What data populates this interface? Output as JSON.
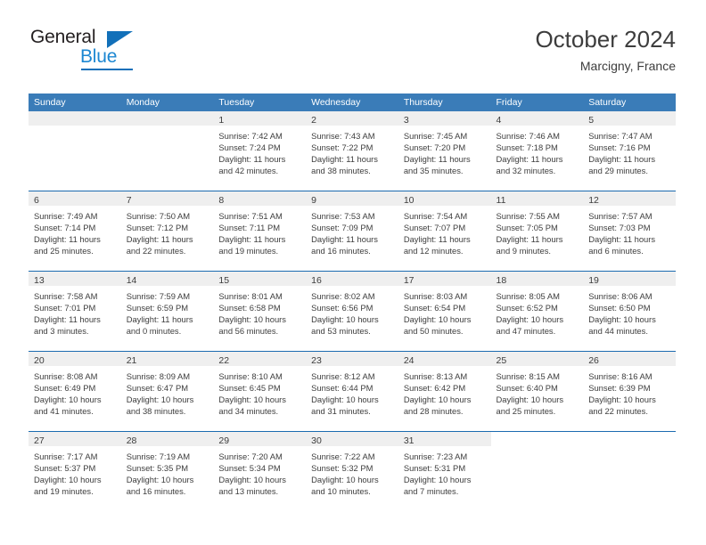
{
  "brand": {
    "name_dark": "General",
    "name_blue": "Blue",
    "logo_icon": "triangle-icon",
    "blue": "#1270b9"
  },
  "header": {
    "title": "October 2024",
    "subtitle": "Marcigny, France"
  },
  "calendar": {
    "header_bg": "#3a7cb8",
    "row_rule": "#1b6bb0",
    "daynum_bg": "#efefef",
    "weekdays": [
      "Sunday",
      "Monday",
      "Tuesday",
      "Wednesday",
      "Thursday",
      "Friday",
      "Saturday"
    ],
    "weeks": [
      [
        {
          "day": "",
          "blank": true,
          "sunrise": "",
          "sunset": "",
          "daylight": ""
        },
        {
          "day": "",
          "blank": true,
          "sunrise": "",
          "sunset": "",
          "daylight": ""
        },
        {
          "day": "1",
          "sunrise": "Sunrise: 7:42 AM",
          "sunset": "Sunset: 7:24 PM",
          "daylight": "Daylight: 11 hours and 42 minutes."
        },
        {
          "day": "2",
          "sunrise": "Sunrise: 7:43 AM",
          "sunset": "Sunset: 7:22 PM",
          "daylight": "Daylight: 11 hours and 38 minutes."
        },
        {
          "day": "3",
          "sunrise": "Sunrise: 7:45 AM",
          "sunset": "Sunset: 7:20 PM",
          "daylight": "Daylight: 11 hours and 35 minutes."
        },
        {
          "day": "4",
          "sunrise": "Sunrise: 7:46 AM",
          "sunset": "Sunset: 7:18 PM",
          "daylight": "Daylight: 11 hours and 32 minutes."
        },
        {
          "day": "5",
          "sunrise": "Sunrise: 7:47 AM",
          "sunset": "Sunset: 7:16 PM",
          "daylight": "Daylight: 11 hours and 29 minutes."
        }
      ],
      [
        {
          "day": "6",
          "sunrise": "Sunrise: 7:49 AM",
          "sunset": "Sunset: 7:14 PM",
          "daylight": "Daylight: 11 hours and 25 minutes."
        },
        {
          "day": "7",
          "sunrise": "Sunrise: 7:50 AM",
          "sunset": "Sunset: 7:12 PM",
          "daylight": "Daylight: 11 hours and 22 minutes."
        },
        {
          "day": "8",
          "sunrise": "Sunrise: 7:51 AM",
          "sunset": "Sunset: 7:11 PM",
          "daylight": "Daylight: 11 hours and 19 minutes."
        },
        {
          "day": "9",
          "sunrise": "Sunrise: 7:53 AM",
          "sunset": "Sunset: 7:09 PM",
          "daylight": "Daylight: 11 hours and 16 minutes."
        },
        {
          "day": "10",
          "sunrise": "Sunrise: 7:54 AM",
          "sunset": "Sunset: 7:07 PM",
          "daylight": "Daylight: 11 hours and 12 minutes."
        },
        {
          "day": "11",
          "sunrise": "Sunrise: 7:55 AM",
          "sunset": "Sunset: 7:05 PM",
          "daylight": "Daylight: 11 hours and 9 minutes."
        },
        {
          "day": "12",
          "sunrise": "Sunrise: 7:57 AM",
          "sunset": "Sunset: 7:03 PM",
          "daylight": "Daylight: 11 hours and 6 minutes."
        }
      ],
      [
        {
          "day": "13",
          "sunrise": "Sunrise: 7:58 AM",
          "sunset": "Sunset: 7:01 PM",
          "daylight": "Daylight: 11 hours and 3 minutes."
        },
        {
          "day": "14",
          "sunrise": "Sunrise: 7:59 AM",
          "sunset": "Sunset: 6:59 PM",
          "daylight": "Daylight: 11 hours and 0 minutes."
        },
        {
          "day": "15",
          "sunrise": "Sunrise: 8:01 AM",
          "sunset": "Sunset: 6:58 PM",
          "daylight": "Daylight: 10 hours and 56 minutes."
        },
        {
          "day": "16",
          "sunrise": "Sunrise: 8:02 AM",
          "sunset": "Sunset: 6:56 PM",
          "daylight": "Daylight: 10 hours and 53 minutes."
        },
        {
          "day": "17",
          "sunrise": "Sunrise: 8:03 AM",
          "sunset": "Sunset: 6:54 PM",
          "daylight": "Daylight: 10 hours and 50 minutes."
        },
        {
          "day": "18",
          "sunrise": "Sunrise: 8:05 AM",
          "sunset": "Sunset: 6:52 PM",
          "daylight": "Daylight: 10 hours and 47 minutes."
        },
        {
          "day": "19",
          "sunrise": "Sunrise: 8:06 AM",
          "sunset": "Sunset: 6:50 PM",
          "daylight": "Daylight: 10 hours and 44 minutes."
        }
      ],
      [
        {
          "day": "20",
          "sunrise": "Sunrise: 8:08 AM",
          "sunset": "Sunset: 6:49 PM",
          "daylight": "Daylight: 10 hours and 41 minutes."
        },
        {
          "day": "21",
          "sunrise": "Sunrise: 8:09 AM",
          "sunset": "Sunset: 6:47 PM",
          "daylight": "Daylight: 10 hours and 38 minutes."
        },
        {
          "day": "22",
          "sunrise": "Sunrise: 8:10 AM",
          "sunset": "Sunset: 6:45 PM",
          "daylight": "Daylight: 10 hours and 34 minutes."
        },
        {
          "day": "23",
          "sunrise": "Sunrise: 8:12 AM",
          "sunset": "Sunset: 6:44 PM",
          "daylight": "Daylight: 10 hours and 31 minutes."
        },
        {
          "day": "24",
          "sunrise": "Sunrise: 8:13 AM",
          "sunset": "Sunset: 6:42 PM",
          "daylight": "Daylight: 10 hours and 28 minutes."
        },
        {
          "day": "25",
          "sunrise": "Sunrise: 8:15 AM",
          "sunset": "Sunset: 6:40 PM",
          "daylight": "Daylight: 10 hours and 25 minutes."
        },
        {
          "day": "26",
          "sunrise": "Sunrise: 8:16 AM",
          "sunset": "Sunset: 6:39 PM",
          "daylight": "Daylight: 10 hours and 22 minutes."
        }
      ],
      [
        {
          "day": "27",
          "sunrise": "Sunrise: 7:17 AM",
          "sunset": "Sunset: 5:37 PM",
          "daylight": "Daylight: 10 hours and 19 minutes."
        },
        {
          "day": "28",
          "sunrise": "Sunrise: 7:19 AM",
          "sunset": "Sunset: 5:35 PM",
          "daylight": "Daylight: 10 hours and 16 minutes."
        },
        {
          "day": "29",
          "sunrise": "Sunrise: 7:20 AM",
          "sunset": "Sunset: 5:34 PM",
          "daylight": "Daylight: 10 hours and 13 minutes."
        },
        {
          "day": "30",
          "sunrise": "Sunrise: 7:22 AM",
          "sunset": "Sunset: 5:32 PM",
          "daylight": "Daylight: 10 hours and 10 minutes."
        },
        {
          "day": "31",
          "sunrise": "Sunrise: 7:23 AM",
          "sunset": "Sunset: 5:31 PM",
          "daylight": "Daylight: 10 hours and 7 minutes."
        },
        {
          "day": "",
          "blank": true,
          "sunrise": "",
          "sunset": "",
          "daylight": ""
        },
        {
          "day": "",
          "blank": true,
          "sunrise": "",
          "sunset": "",
          "daylight": ""
        }
      ]
    ]
  }
}
